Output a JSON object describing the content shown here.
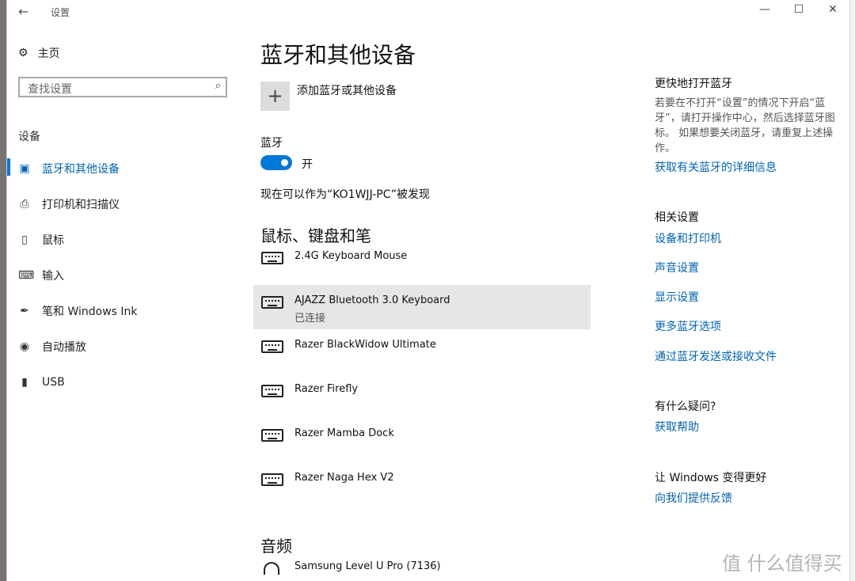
{
  "window": {
    "title": "设置"
  },
  "sidebar": {
    "home": "主页",
    "search_placeholder": "查找设置",
    "section_label": "设备",
    "items": [
      {
        "label": "蓝牙和其他设备",
        "icon": "bluetooth-devices-icon",
        "active": true
      },
      {
        "label": "打印机和扫描仪",
        "icon": "printer-icon"
      },
      {
        "label": "鼠标",
        "icon": "mouse-icon"
      },
      {
        "label": "输入",
        "icon": "keyboard-icon"
      },
      {
        "label": "笔和 Windows Ink",
        "icon": "pen-icon"
      },
      {
        "label": "自动播放",
        "icon": "autoplay-icon"
      },
      {
        "label": "USB",
        "icon": "usb-icon"
      }
    ]
  },
  "main": {
    "title": "蓝牙和其他设备",
    "add_device": "添加蓝牙或其他设备",
    "bluetooth_label": "蓝牙",
    "toggle_state": "开",
    "discoverable": "现在可以作为“KO1WJJ-PC”被发现",
    "mouse_section": "鼠标、键盘和笔",
    "devices": [
      {
        "name": "2.4G Keyboard Mouse"
      },
      {
        "name": "AJAZZ Bluetooth 3.0 Keyboard",
        "status": "已连接",
        "selected": true
      },
      {
        "name": "Razer BlackWidow Ultimate"
      },
      {
        "name": "Razer Firefly"
      },
      {
        "name": "Razer Mamba Dock"
      },
      {
        "name": "Razer Naga Hex V2"
      }
    ],
    "audio_section": "音频",
    "audio_device": "Samsung Level U Pro (7136)"
  },
  "side": {
    "quick_title": "更快地打开蓝牙",
    "quick_text": "若要在不打开“设置”的情况下开启“蓝牙”，请打开操作中心，然后选择蓝牙图标。 如果想要关闭蓝牙，请重复上述操作。",
    "quick_link": "获取有关蓝牙的详细信息",
    "related_title": "相关设置",
    "related_links": [
      "设备和打印机",
      "声音设置",
      "显示设置",
      "更多蓝牙选项",
      "通过蓝牙发送或接收文件"
    ],
    "question_title": "有什么疑问?",
    "help_link": "获取帮助",
    "better_title": "让 Windows 变得更好",
    "feedback_link": "向我们提供反馈"
  },
  "watermark": "值 什么值得买",
  "colors": {
    "accent": "#0078d7",
    "link": "#0063b1",
    "selected_row": "#e6e6e6"
  }
}
